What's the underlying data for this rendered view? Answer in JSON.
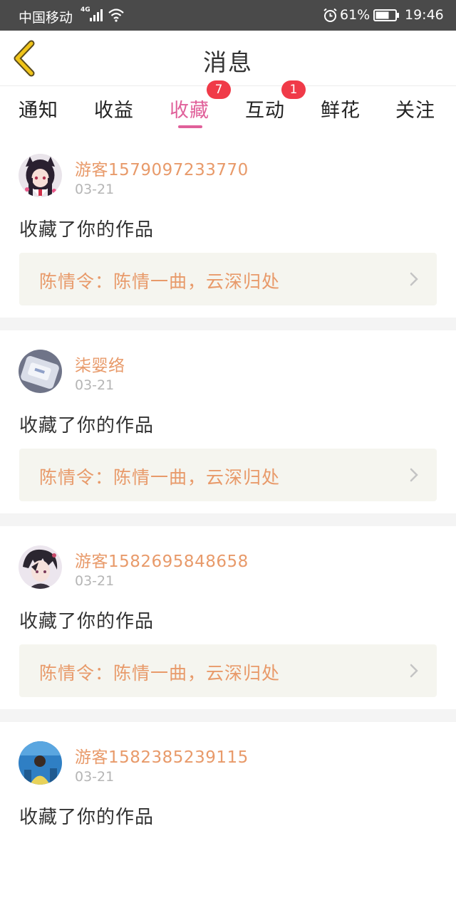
{
  "status_bar": {
    "carrier": "中国移动",
    "network": "4G",
    "battery_percent": "61%",
    "time": "19:46"
  },
  "header": {
    "back_icon": "chevron-left-icon",
    "title": "消息",
    "accent_color": "#f0c419"
  },
  "tabs": [
    {
      "label": "通知",
      "badge": "",
      "active": false
    },
    {
      "label": "收益",
      "badge": "",
      "active": false
    },
    {
      "label": "收藏",
      "badge": "7",
      "active": true
    },
    {
      "label": "互动",
      "badge": "1",
      "active": false
    },
    {
      "label": "鲜花",
      "badge": "",
      "active": false
    },
    {
      "label": "关注",
      "badge": "",
      "active": false
    }
  ],
  "colors": {
    "active_tab": "#e0609a",
    "badge": "#f03a48",
    "username": "#e89a6a",
    "status_bar": "#4a4a4a"
  },
  "messages": [
    {
      "user": "游客1579097233770",
      "date": "03-21",
      "text": "收藏了你的作品",
      "work": "陈情令：陈情一曲，云深归处"
    },
    {
      "user": "柒婴络",
      "date": "03-21",
      "text": "收藏了你的作品",
      "work": "陈情令：陈情一曲，云深归处"
    },
    {
      "user": "游客1582695848658",
      "date": "03-21",
      "text": "收藏了你的作品",
      "work": "陈情令：陈情一曲，云深归处"
    },
    {
      "user": "游客1582385239115",
      "date": "03-21",
      "text": "收藏了你的作品",
      "work": ""
    }
  ]
}
